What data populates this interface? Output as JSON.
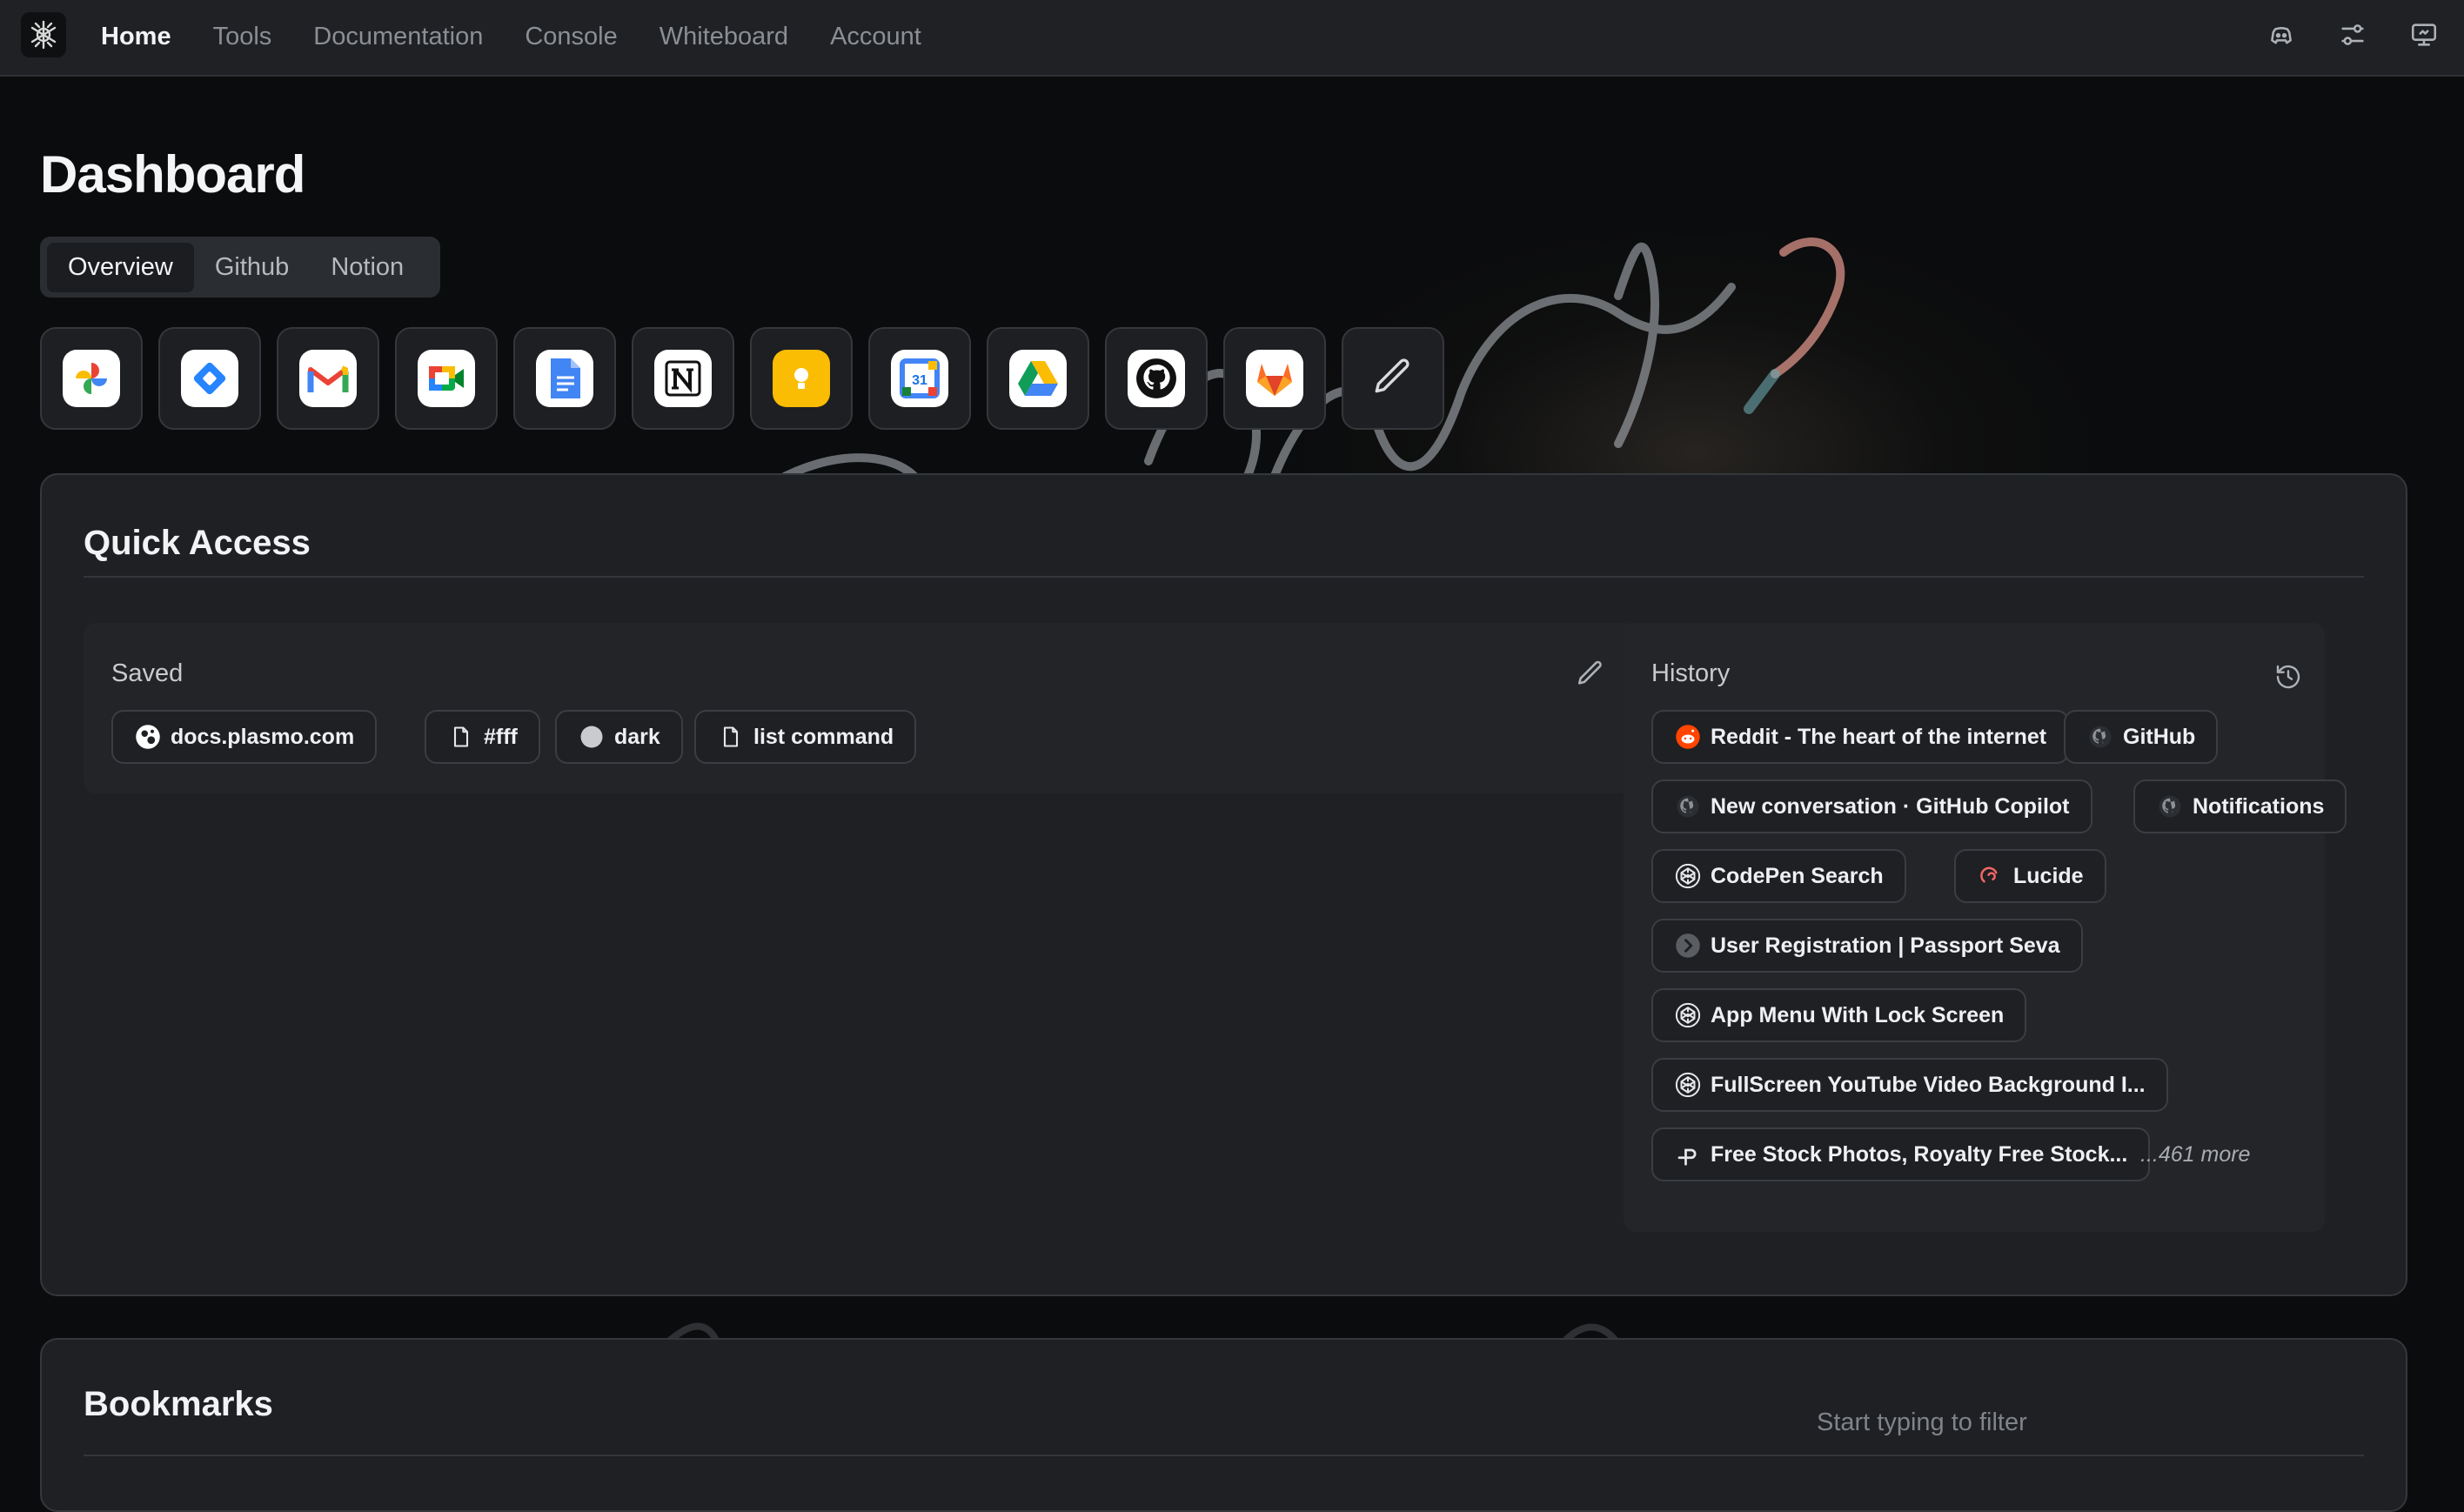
{
  "nav": {
    "items": [
      {
        "label": "Home",
        "active": true
      },
      {
        "label": "Tools",
        "active": false
      },
      {
        "label": "Documentation",
        "active": false
      },
      {
        "label": "Console",
        "active": false
      },
      {
        "label": "Whiteboard",
        "active": false
      },
      {
        "label": "Account",
        "active": false
      }
    ],
    "right_icons": [
      "discord-icon",
      "settings-sliders-icon",
      "monitor-icon"
    ]
  },
  "dashboard": {
    "title": "Dashboard",
    "tabs": [
      {
        "label": "Overview",
        "active": true
      },
      {
        "label": "Github",
        "active": false
      },
      {
        "label": "Notion",
        "active": false
      }
    ],
    "apps": [
      {
        "name": "google-photos-icon"
      },
      {
        "name": "jira-icon"
      },
      {
        "name": "gmail-icon"
      },
      {
        "name": "google-meet-icon"
      },
      {
        "name": "google-docs-icon"
      },
      {
        "name": "notion-icon"
      },
      {
        "name": "google-keep-icon"
      },
      {
        "name": "google-calendar-icon",
        "text": "31"
      },
      {
        "name": "google-drive-icon"
      },
      {
        "name": "github-icon"
      },
      {
        "name": "gitlab-icon"
      },
      {
        "name": "edit-pencil-icon"
      }
    ]
  },
  "quick_access": {
    "title": "Quick Access",
    "saved": {
      "label": "Saved",
      "items": [
        {
          "label": "docs.plasmo.com",
          "icon": "plasmo-icon"
        },
        {
          "label": "#fff",
          "icon": "file-icon"
        },
        {
          "label": "dark",
          "icon": "circle-icon"
        },
        {
          "label": "list command",
          "icon": "file-icon"
        }
      ]
    },
    "history": {
      "label": "History",
      "items": [
        {
          "label": "Reddit - The heart of the internet",
          "icon": "reddit-icon"
        },
        {
          "label": "GitHub",
          "icon": "github-icon"
        },
        {
          "label": "New conversation · GitHub Copilot",
          "icon": "github-icon"
        },
        {
          "label": "Notifications",
          "icon": "github-icon"
        },
        {
          "label": "CodePen Search",
          "icon": "codepen-icon"
        },
        {
          "label": "Lucide",
          "icon": "lucide-icon"
        },
        {
          "label": "User Registration | Passport Seva",
          "icon": "chevron-circle-icon"
        },
        {
          "label": "App Menu With Lock Screen",
          "icon": "codepen-icon"
        },
        {
          "label": "FullScreen YouTube Video Background I...",
          "icon": "codepen-icon"
        },
        {
          "label": "Free Stock Photos, Royalty Free Stock...",
          "icon": "pexels-icon"
        }
      ],
      "more": "...461 more"
    }
  },
  "bookmarks": {
    "title": "Bookmarks",
    "filter_placeholder": "Start typing to filter"
  },
  "colors": {
    "page_bg": "#0b0c0d",
    "card_bg": "#1e2023",
    "topbar_bg": "#1f2124",
    "reddit": "#ff4500",
    "lucide": "#f56565"
  }
}
